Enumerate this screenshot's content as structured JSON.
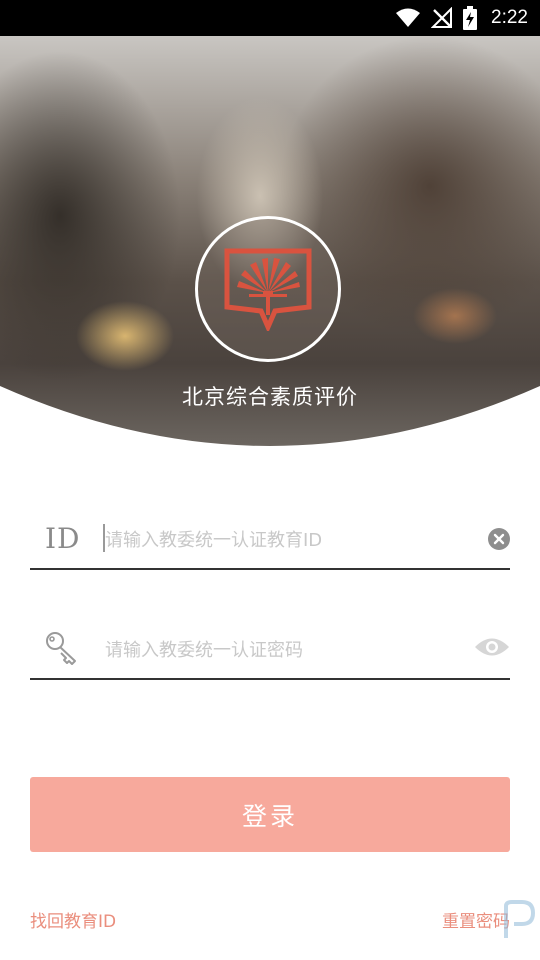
{
  "status_bar": {
    "time": "2:22",
    "icons": [
      "wifi-icon",
      "no-signal-icon",
      "battery-charging-icon"
    ]
  },
  "header": {
    "app_title": "北京综合素质评价",
    "logo_icon": "palm-shield-logo"
  },
  "form": {
    "id_field": {
      "label": "ID",
      "placeholder": "请输入教委统一认证教育ID",
      "value": "",
      "clear_icon": "clear-icon"
    },
    "password_field": {
      "icon": "key-icon",
      "placeholder": "请输入教委统一认证密码",
      "value": "",
      "visibility_icon": "eye-icon"
    },
    "login_label": "登录"
  },
  "links": {
    "recover_id": "找回教育ID",
    "reset_password": "重置密码"
  },
  "colors": {
    "accent": "#ea8e7d",
    "button": "#f7a99c",
    "logo_red": "#d9533f",
    "status_bar": "#000000"
  }
}
